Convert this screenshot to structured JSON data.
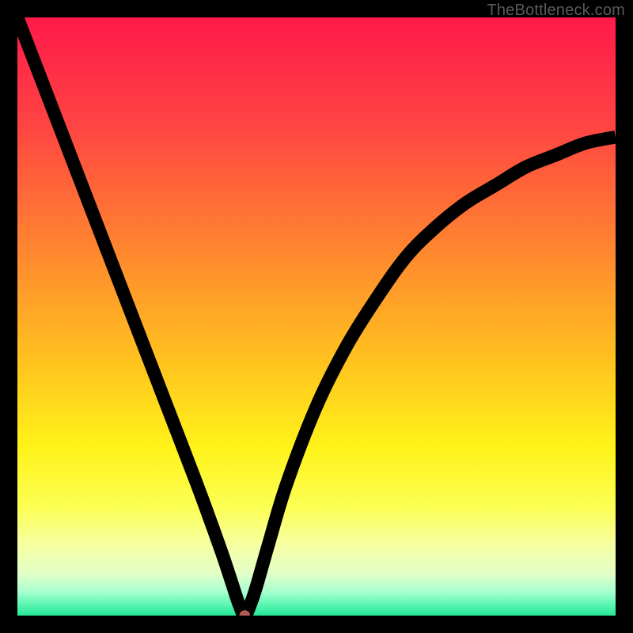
{
  "watermark": "TheBottleneck.com",
  "colors": {
    "borders": "#000000",
    "curve": "#000000",
    "point": "#b25a54",
    "gradient_stops": [
      {
        "offset": "0%",
        "color": "#ff1a4a"
      },
      {
        "offset": "18%",
        "color": "#ff4443"
      },
      {
        "offset": "40%",
        "color": "#ff8a2e"
      },
      {
        "offset": "58%",
        "color": "#ffc41e"
      },
      {
        "offset": "72%",
        "color": "#fff31a"
      },
      {
        "offset": "82%",
        "color": "#fcff55"
      },
      {
        "offset": "88%",
        "color": "#f6ffa0"
      },
      {
        "offset": "93%",
        "color": "#e2ffc8"
      },
      {
        "offset": "96%",
        "color": "#a8ffd0"
      },
      {
        "offset": "98%",
        "color": "#60f7b3"
      },
      {
        "offset": "100%",
        "color": "#25e896"
      }
    ]
  },
  "chart_data": {
    "type": "line",
    "title": "",
    "xlabel": "",
    "ylabel": "",
    "xlim": [
      0,
      100
    ],
    "ylim": [
      0,
      100
    ],
    "note": "V-shaped bottleneck curve; minimum (zero bottleneck) near x≈38; vertical axis encodes bottleneck percentage where red=high and green=low.",
    "series": [
      {
        "name": "bottleneck-curve",
        "x": [
          0,
          5,
          10,
          15,
          20,
          25,
          30,
          34,
          36,
          37,
          38,
          39,
          40,
          42,
          45,
          50,
          55,
          60,
          65,
          70,
          75,
          80,
          85,
          90,
          95,
          100
        ],
        "y": [
          100,
          87,
          74,
          61,
          48,
          35,
          22,
          11,
          5,
          2,
          0,
          2,
          5,
          12,
          22,
          35,
          45,
          53,
          60,
          65,
          69,
          72,
          75,
          77,
          79,
          80
        ]
      }
    ],
    "annotations": [
      {
        "name": "optimal-point",
        "x": 38,
        "y": 0
      }
    ]
  }
}
